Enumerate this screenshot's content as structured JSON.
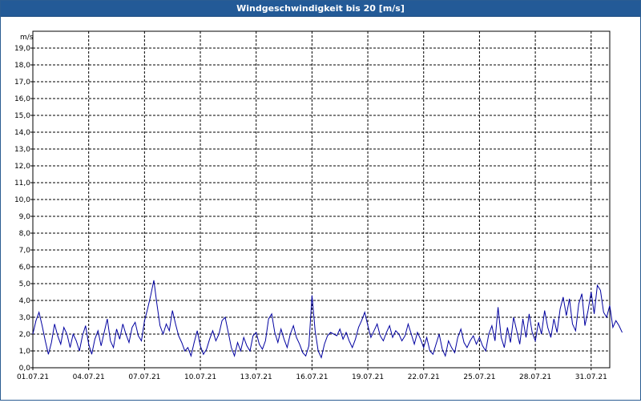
{
  "window": {
    "title": "Windgeschwindigkeit bis 20 [m/s]"
  },
  "chart_data": {
    "type": "line",
    "title": "Windgeschwindigkeit bis 20 [m/s]",
    "unit": "m/s",
    "xlim": [
      "01.07.21 00:00",
      "01.08.21 00:00"
    ],
    "ylim": [
      0,
      20
    ],
    "grid": true,
    "y_ticks": [
      "0,0",
      "1,0",
      "2,0",
      "3,0",
      "4,0",
      "5,0",
      "6,0",
      "7,0",
      "8,0",
      "9,0",
      "10,0",
      "11,0",
      "12,0",
      "13,0",
      "14,0",
      "15,0",
      "16,0",
      "17,0",
      "18,0",
      "19,0"
    ],
    "x_ticks": [
      "01.07.21",
      "04.07.21",
      "07.07.21",
      "10.07.21",
      "13.07.21",
      "16.07.21",
      "19.07.21",
      "22.07.21",
      "25.07.21",
      "28.07.21",
      "31.07.21"
    ],
    "line_color": "#0000a0",
    "series": [
      {
        "values_step_hours": 4,
        "values": [
          2.0,
          2.8,
          3.3,
          2.5,
          1.6,
          0.8,
          1.5,
          2.6,
          1.9,
          1.4,
          2.4,
          2.0,
          1.2,
          2.0,
          1.6,
          1.0,
          1.9,
          2.5,
          1.4,
          0.8,
          1.7,
          2.2,
          1.3,
          2.1,
          2.9,
          1.6,
          1.2,
          2.3,
          1.7,
          2.6,
          2.0,
          1.5,
          2.4,
          2.7,
          1.9,
          1.6,
          2.8,
          3.5,
          4.3,
          5.2,
          3.8,
          2.5,
          2.0,
          2.6,
          2.2,
          3.4,
          2.6,
          1.9,
          1.5,
          1.0,
          1.2,
          0.7,
          1.5,
          2.2,
          1.3,
          0.8,
          1.1,
          1.7,
          2.2,
          1.6,
          2.0,
          2.8,
          3.0,
          2.1,
          1.2,
          0.7,
          1.5,
          1.0,
          1.8,
          1.3,
          1.0,
          1.9,
          2.1,
          1.4,
          1.1,
          1.6,
          2.9,
          3.2,
          2.1,
          1.5,
          2.3,
          1.7,
          1.2,
          2.0,
          2.5,
          1.8,
          1.4,
          0.9,
          0.7,
          1.3,
          4.3,
          2.2,
          1.0,
          0.6,
          1.4,
          1.9,
          2.1,
          2.0,
          1.9,
          2.3,
          1.7,
          2.1,
          1.6,
          1.2,
          1.7,
          2.4,
          2.8,
          3.3,
          2.5,
          1.8,
          2.2,
          2.6,
          1.9,
          1.6,
          2.1,
          2.5,
          1.8,
          2.2,
          2.0,
          1.6,
          1.9,
          2.6,
          2.0,
          1.4,
          2.1,
          1.7,
          1.2,
          1.8,
          1.0,
          0.8,
          1.4,
          2.0,
          1.1,
          0.7,
          1.6,
          1.2,
          0.9,
          1.8,
          2.3,
          1.5,
          1.2,
          1.6,
          1.9,
          1.4,
          1.8,
          1.3,
          1.0,
          2.0,
          2.5,
          1.6,
          3.6,
          1.8,
          1.2,
          2.4,
          1.5,
          3.0,
          2.2,
          1.4,
          2.9,
          1.8,
          3.2,
          2.1,
          1.6,
          2.7,
          2.0,
          3.4,
          2.4,
          1.8,
          2.9,
          2.1,
          3.5,
          4.2,
          3.1,
          4.1,
          2.6,
          2.2,
          3.8,
          4.4,
          2.5,
          3.4,
          4.5,
          3.2,
          4.9,
          4.6,
          3.3,
          3.0,
          3.7,
          2.4,
          2.8,
          2.5,
          2.1
        ]
      }
    ]
  }
}
